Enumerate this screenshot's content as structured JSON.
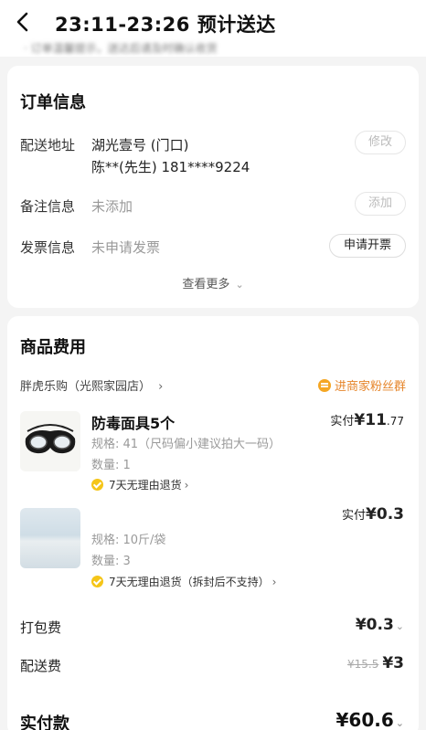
{
  "header": {
    "title": "23:11-23:26 预计送达",
    "subtitle_blurred": "· 订单温馨提示，送达后请及时确认收货"
  },
  "order_info": {
    "title": "订单信息",
    "address": {
      "label": "配送地址",
      "line1": "湖光壹号 (门口)",
      "line2": "陈**(先生) 181****9224",
      "action": "修改"
    },
    "note": {
      "label": "备注信息",
      "value": "未添加",
      "action": "添加"
    },
    "invoice": {
      "label": "发票信息",
      "value": "未申请发票",
      "action": "申请开票"
    },
    "see_more": "查看更多"
  },
  "goods": {
    "title": "商品费用",
    "shop_name": "胖虎乐购（光熙家园店）",
    "fan_group": "进商家粉丝群",
    "items": [
      {
        "name": "防毒面具5个",
        "spec": "规格: 41（尺码偏小建议拍大一码）",
        "qty": "数量: 1",
        "price_prefix": "实付",
        "price_main": "¥11",
        "price_cents": ".77",
        "return_policy": "7天无理由退货"
      },
      {
        "spec": "规格: 10斤/袋",
        "qty": "数量: 3",
        "price_prefix": "实付",
        "price_main": "¥0.3",
        "return_policy": "7天无理由退货（拆封后不支持）"
      }
    ],
    "packing_fee": {
      "label": "打包费",
      "value": "¥0.3"
    },
    "delivery_fee": {
      "label": "配送费",
      "original": "¥15.5",
      "value": "¥3"
    },
    "total": {
      "label": "实付款",
      "value": "¥60.6"
    }
  },
  "colors": {
    "accent_orange": "#e6852a",
    "check_yellow": "#f5c518",
    "background": "#f4f4f4"
  }
}
